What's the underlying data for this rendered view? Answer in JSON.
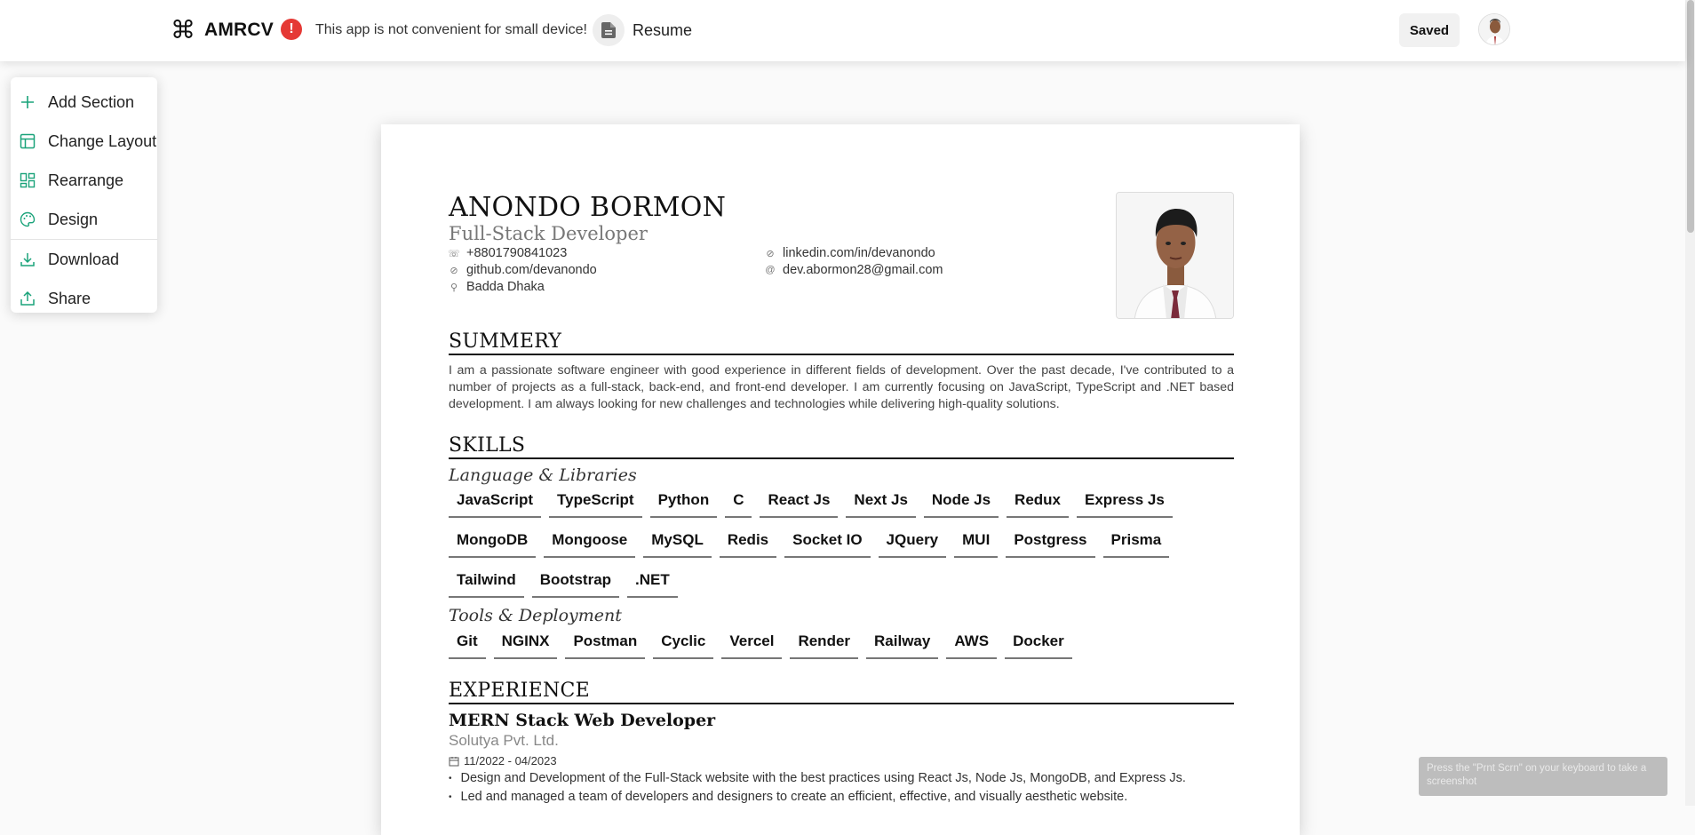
{
  "header": {
    "brand": "AMRCV",
    "warning": "This app is not convenient for small device!",
    "doc_label": "Resume",
    "saved_label": "Saved"
  },
  "menu": {
    "items": [
      {
        "label": "Add Section",
        "icon": "plus-icon"
      },
      {
        "label": "Change Layout",
        "icon": "layout-icon"
      },
      {
        "label": "Rearrange",
        "icon": "grid-icon"
      },
      {
        "label": "Design",
        "icon": "palette-icon"
      },
      {
        "label": "Download",
        "icon": "download-icon"
      },
      {
        "label": "Share",
        "icon": "share-icon"
      }
    ]
  },
  "resume": {
    "name": "ANONDO BORMON",
    "title": "Full-Stack Developer",
    "contacts": {
      "phone": "+8801790841023",
      "github": "github.com/devanondo",
      "location": "Badda Dhaka",
      "linkedin": "linkedin.com/in/devanondo",
      "email": "dev.abormon28@gmail.com"
    },
    "summary_heading": "SUMMERY",
    "summary": "I am a passionate software engineer with good experience in different fields of development. Over the past decade, I've contributed to a number of projects as a full-stack, back-end, and front-end developer. I am currently focusing on JavaScript, TypeScript and .NET based development. I am always looking for new challenges and technologies while delivering high-quality solutions.",
    "skills_heading": "SKILLS",
    "skill_groups": [
      {
        "title": "Language & Libraries",
        "items": [
          "JavaScript",
          "TypeScript",
          "Python",
          "C",
          "React Js",
          "Next Js",
          "Node Js",
          "Redux",
          "Express Js",
          "MongoDB",
          "Mongoose",
          "MySQL",
          "Redis",
          "Socket IO",
          "JQuery",
          "MUI",
          "Postgress",
          "Prisma",
          "Tailwind",
          "Bootstrap",
          ".NET"
        ]
      },
      {
        "title": "Tools & Deployment",
        "items": [
          "Git",
          "NGINX",
          "Postman",
          "Cyclic",
          "Vercel",
          "Render",
          "Railway",
          "AWS",
          "Docker"
        ]
      }
    ],
    "experience_heading": "EXPERIENCE",
    "experience": {
      "role": "MERN Stack Web Developer",
      "company": "Solutya Pvt. Ltd.",
      "dates": "11/2022 - 04/2023",
      "bullets": [
        "Design and Development of the Full-Stack website with the best practices using React Js, Node Js, MongoDB, and Express Js.",
        "Led and managed a team of developers and designers to create an efficient, effective, and visually aesthetic website."
      ]
    }
  },
  "toast": "Press the \"Prnt Scrn\" on your keyboard to take a screenshot",
  "colors": {
    "accent": "#1aa37a",
    "warning": "#e53935"
  }
}
